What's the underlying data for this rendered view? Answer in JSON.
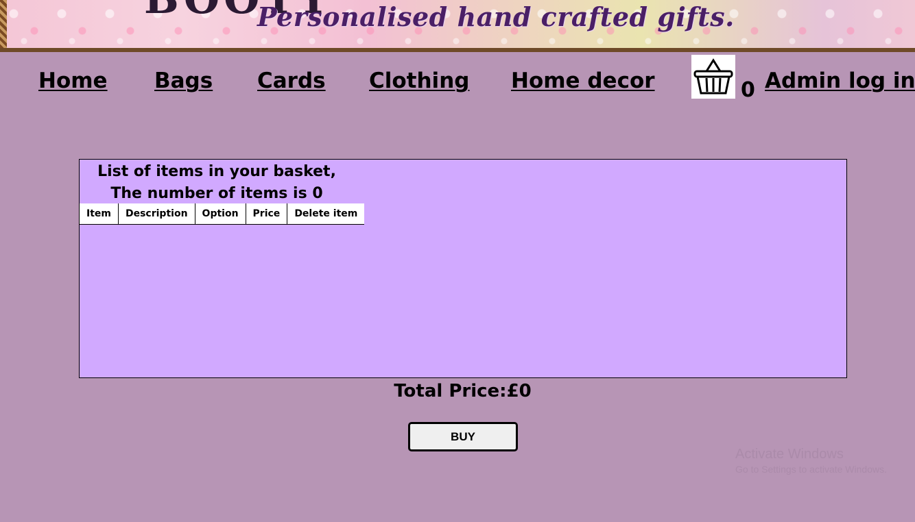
{
  "banner": {
    "tagline": "Personalised hand crafted gifts."
  },
  "nav": {
    "items": [
      {
        "label": "Home"
      },
      {
        "label": "Bags"
      },
      {
        "label": "Cards"
      },
      {
        "label": "Clothing"
      },
      {
        "label": "Home decor"
      }
    ],
    "admin_label": "Admin log in"
  },
  "basket": {
    "icon": "shopping-basket-icon",
    "count": "0"
  },
  "panel": {
    "title": "List of items in your basket, The number of items is 0",
    "table": {
      "headers": [
        "Item",
        "Description",
        "Option",
        "Price",
        "Delete item"
      ],
      "rows": []
    }
  },
  "total": {
    "text": "Total Price:£0"
  },
  "buy": {
    "label": "BUY"
  },
  "watermark": {
    "line1": "Activate Windows",
    "line2": "Go to Settings to activate Windows."
  },
  "colors": {
    "page_background": "#b795b5",
    "panel_background": "#d1a9ff",
    "tagline": "#4a1f66"
  }
}
